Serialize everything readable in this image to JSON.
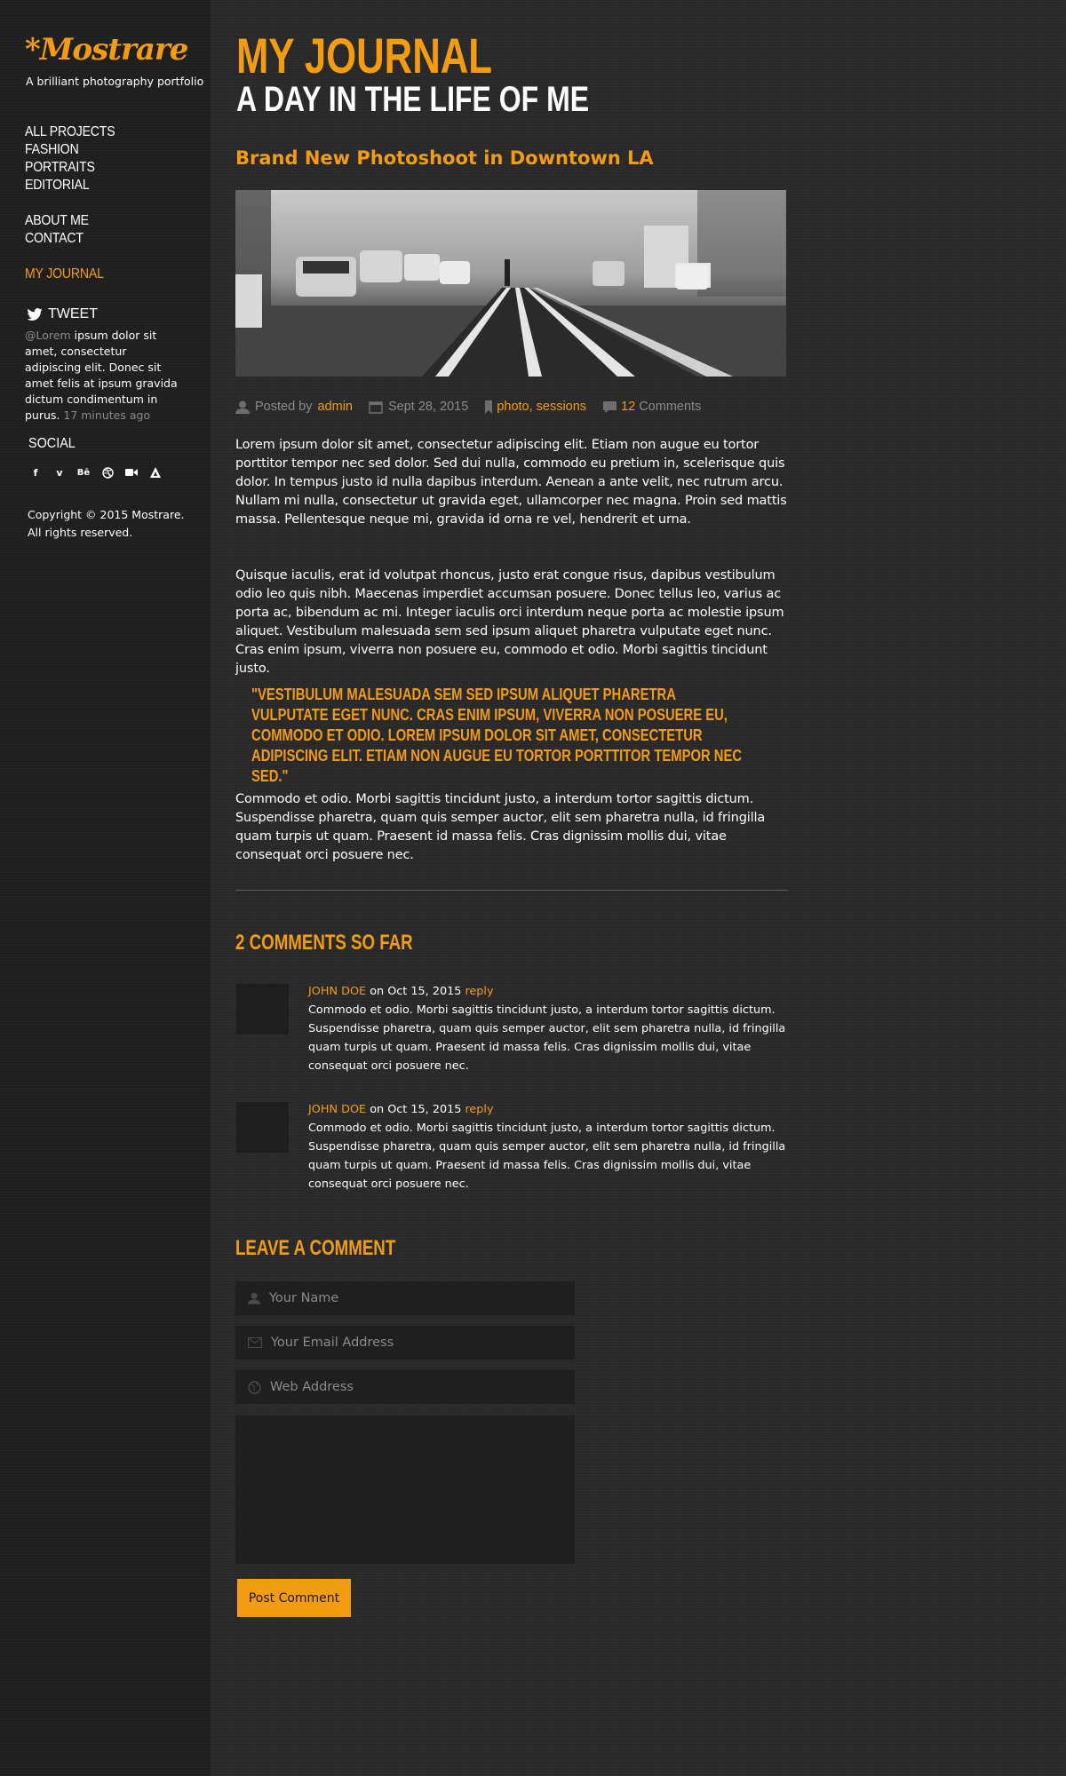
{
  "sidebar": {
    "logo": "*Mostrare",
    "tagline": "A brilliant photography portfolio",
    "nav_group1": [
      "ALL PROJECTS",
      "FASHION",
      "PORTRAITS",
      "EDITORIAL"
    ],
    "nav_group2": [
      "ABOUT ME",
      "CONTACT"
    ],
    "nav_active": "MY JOURNAL",
    "tweet": {
      "heading": "TWEET",
      "handle": "@Lorem",
      "text": " ipsum dolor sit amet, consectetur adipiscing elit. Donec sit amet felis at ipsum gravida dictum condimentum in purus.",
      "time": " 17 minutes ago"
    },
    "social": {
      "heading": "SOCIAL",
      "icons": [
        "facebook-icon",
        "vimeo-icon",
        "behance-icon",
        "dribbble-icon",
        "video-icon",
        "triangle-logo-icon"
      ]
    },
    "copyright_line1": "Copyright © 2015 Mostrare.",
    "copyright_line2": "All rights reserved."
  },
  "header": {
    "title": "MY JOURNAL",
    "subtitle": "A DAY IN THE LIFE OF ME"
  },
  "post": {
    "title": "Brand New Photoshoot in Downtown LA",
    "meta": {
      "posted_by_label": "Posted by",
      "author": "admin",
      "date": "Sept 28, 2015",
      "tag1": "photo",
      "tag_sep": ",",
      "tag2": "sessions",
      "comment_count": "12",
      "comments_label": "Comments"
    },
    "paragraph1": "Lorem ipsum dolor sit amet, consectetur adipiscing elit. Etiam non augue eu tortor porttitor tempor nec sed dolor. Sed dui nulla, commodo eu pretium in, scelerisque quis dolor. In tempus justo id nulla dapibus interdum. Aenean a ante velit, nec rutrum arcu. Nullam mi nulla, consectetur ut gravida eget, ullamcorper nec magna. Proin sed mattis massa. Pellentesque neque mi, gravida id orna re vel, hendrerit et urna.",
    "paragraph2": "Quisque iaculis, erat id volutpat rhoncus, justo erat congue risus, dapibus vestibulum odio leo quis nibh. Maecenas imperdiet accumsan posuere. Donec tellus leo, varius ac porta ac, bibendum ac mi. Integer iaculis orci interdum neque porta ac molestie ipsum aliquet. Vestibulum malesuada sem sed ipsum aliquet pharetra vulputate eget nunc. Cras enim ipsum, viverra non posuere eu, commodo et odio. Morbi sagittis tincidunt justo.",
    "quote": "\"VESTIBULUM MALESUADA SEM SED IPSUM ALIQUET PHARETRA VULPUTATE EGET NUNC. CRAS ENIM IPSUM, VIVERRA NON POSUERE EU, COMMODO ET ODIO. LOREM IPSUM DOLOR SIT AMET, CONSECTETUR ADIPISCING ELIT. ETIAM NON AUGUE EU TORTOR PORTTITOR TEMPOR NEC SED.\"",
    "paragraph3": "Commodo et odio. Morbi sagittis tincidunt justo, a interdum tortor sagittis dictum. Suspendisse pharetra, quam quis semper auctor, elit sem pharetra nulla, id fringilla quam turpis ut quam. Praesent id massa felis. Cras dignissim mollis dui, vitae consequat orci posuere nec."
  },
  "comments": {
    "heading": "2 COMMENTS SO FAR",
    "items": [
      {
        "author": "JOHN DOE",
        "date_text": " on Oct 15, 2015 ",
        "reply": "reply",
        "text": "Commodo et odio. Morbi sagittis tincidunt justo, a interdum tortor sagittis dictum. Suspendisse pharetra, quam quis semper auctor, elit sem pharetra nulla, id fringilla quam turpis ut quam. Praesent id massa felis. Cras dignissim mollis dui, vitae consequat orci posuere nec."
      },
      {
        "author": "JOHN DOE",
        "date_text": " on Oct 15, 2015 ",
        "reply": "reply",
        "text": "Commodo et odio. Morbi sagittis tincidunt justo, a interdum tortor sagittis dictum. Suspendisse pharetra, quam quis semper auctor, elit sem pharetra nulla, id fringilla quam turpis ut quam. Praesent id massa felis. Cras dignissim mollis dui, vitae consequat orci posuere nec."
      }
    ]
  },
  "form": {
    "heading": "LEAVE A COMMENT",
    "name_placeholder": "Your Name",
    "email_placeholder": "Your Email Address",
    "web_placeholder": "Web Address",
    "submit_label": "Post Comment"
  },
  "colors": {
    "accent": "#f39c12",
    "background": "#2a2a2a",
    "sidebar": "#1f1f1f"
  }
}
